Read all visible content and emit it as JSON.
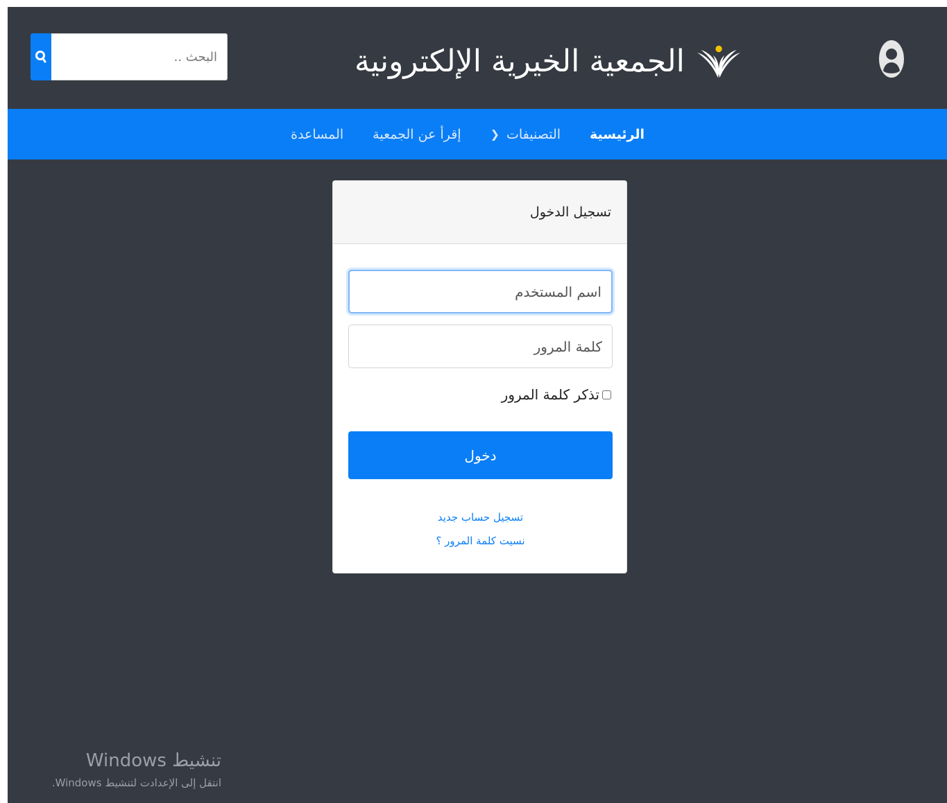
{
  "header": {
    "site_title": "الجمعية الخيرية الإلكترونية",
    "search_placeholder": "البحث ..",
    "search_icon": "search-icon",
    "logo_icon": "wheat-person-logo-icon",
    "user_icon": "user-avatar-icon"
  },
  "nav": {
    "items": [
      {
        "label": "الرئيسية",
        "active": true
      },
      {
        "label": "التصنيفات",
        "has_dropdown": true
      },
      {
        "label": "إقرأ عن الجمعية"
      },
      {
        "label": "المساعدة"
      }
    ]
  },
  "login": {
    "title": "تسجيل الدخول",
    "username_placeholder": "اسم المستخدم",
    "password_placeholder": "كلمة المرور",
    "remember_label": "تذكر كلمة المرور",
    "submit_label": "دخول",
    "register_link": "تسجيل حساب جديد",
    "forgot_link": "نسيت كلمة المرور ؟"
  },
  "watermark": {
    "title": "تنشيط Windows",
    "subtitle": "انتقل إلى الإعدادت لتنشيط Windows."
  },
  "colors": {
    "background": "#363a42",
    "accent": "#0a7ef6",
    "card": "#ffffff"
  }
}
